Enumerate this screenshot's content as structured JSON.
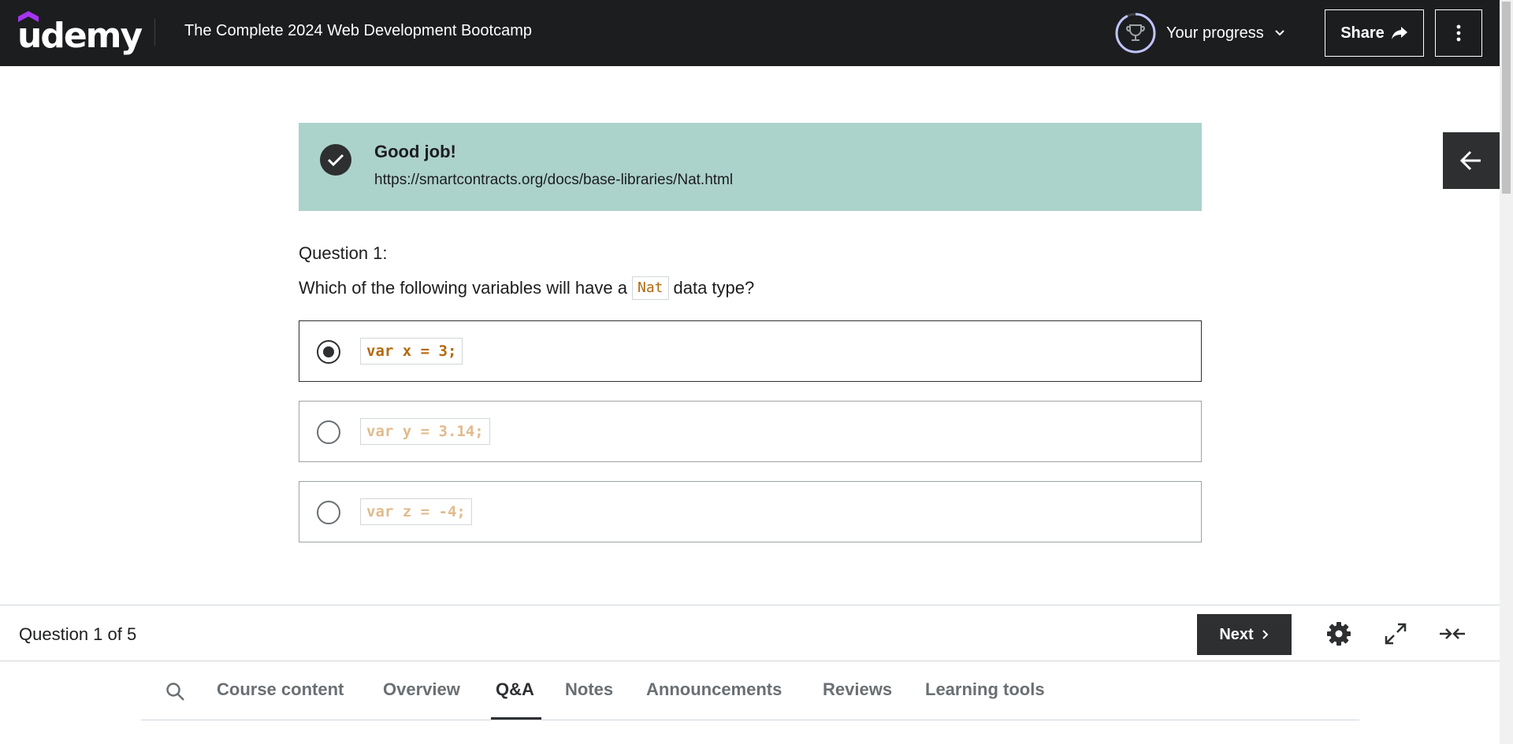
{
  "header": {
    "logo_text": "udemy",
    "course_title": "The Complete 2024 Web Development Bootcamp",
    "progress_label": "Your progress",
    "share_label": "Share"
  },
  "banner": {
    "title": "Good job!",
    "link": "https://smartcontracts.org/docs/base-libraries/Nat.html"
  },
  "question": {
    "label": "Question 1:",
    "text_before": "Which of the following variables will have a",
    "code": "Nat",
    "text_after": "data type?",
    "options": [
      {
        "code": "var x = 3;",
        "selected": true
      },
      {
        "code": "var y = 3.14;",
        "selected": false
      },
      {
        "code": "var z = -4;",
        "selected": false
      }
    ]
  },
  "footer": {
    "question_count": "Question 1 of 5",
    "next_label": "Next"
  },
  "tabs": {
    "items": [
      "Course content",
      "Overview",
      "Q&A",
      "Notes",
      "Announcements",
      "Reviews",
      "Learning tools"
    ],
    "active": "Q&A"
  },
  "colors": {
    "header_bg": "#1c1d1f",
    "banner_bg": "#acd2cc",
    "code_color": "#b4690e",
    "brand_purple": "#a435f0"
  }
}
